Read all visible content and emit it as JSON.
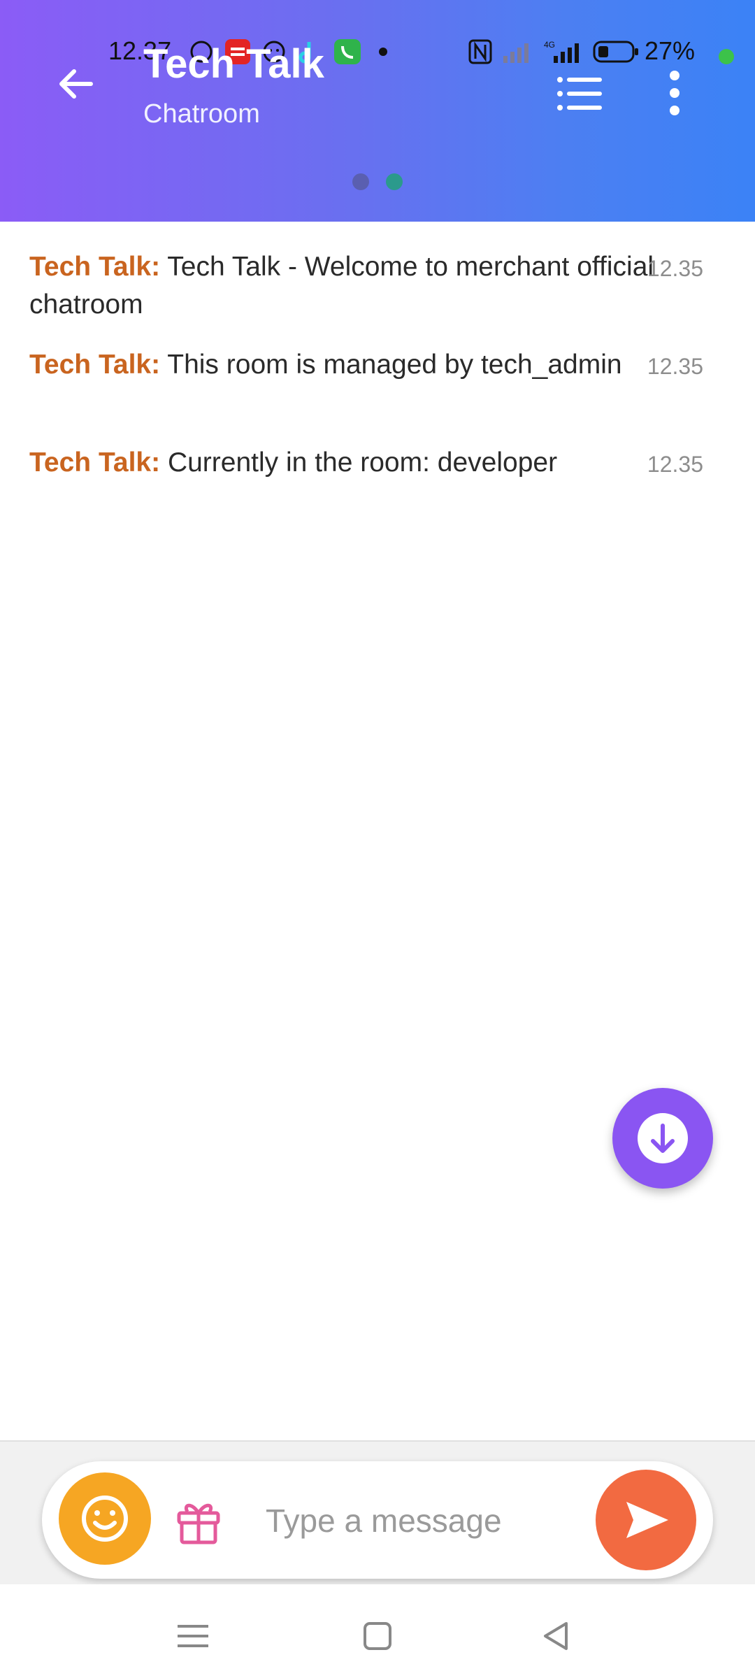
{
  "status_bar": {
    "time": "12.37",
    "battery": "27%",
    "network": "4G"
  },
  "header": {
    "title": "Tech Talk",
    "subtitle": "Chatroom",
    "gradient_start": "#8b5cf6",
    "gradient_end": "#3b82f6"
  },
  "pager": {
    "dots": [
      "#5a5fb0",
      "#2b9a8c"
    ]
  },
  "messages": [
    {
      "sender": "Tech Talk:",
      "text": "Tech Talk - Welcome to merchant official chatroom",
      "time": "12.35"
    },
    {
      "sender": "Tech Talk:",
      "text": "This room is managed by tech_admin",
      "time": "12.35"
    },
    {
      "sender": "Tech Talk:",
      "text": "Currently in the room: developer",
      "time": "12.35"
    }
  ],
  "composer": {
    "placeholder": "Type a message",
    "emoji_icon": "smiley-icon",
    "gift_icon": "gift-icon",
    "send_icon": "send-icon"
  },
  "colors": {
    "sender": "#c9641f",
    "fab": "#8a55f2",
    "emoji_button": "#f6a623",
    "send_button": "#f26a41"
  }
}
